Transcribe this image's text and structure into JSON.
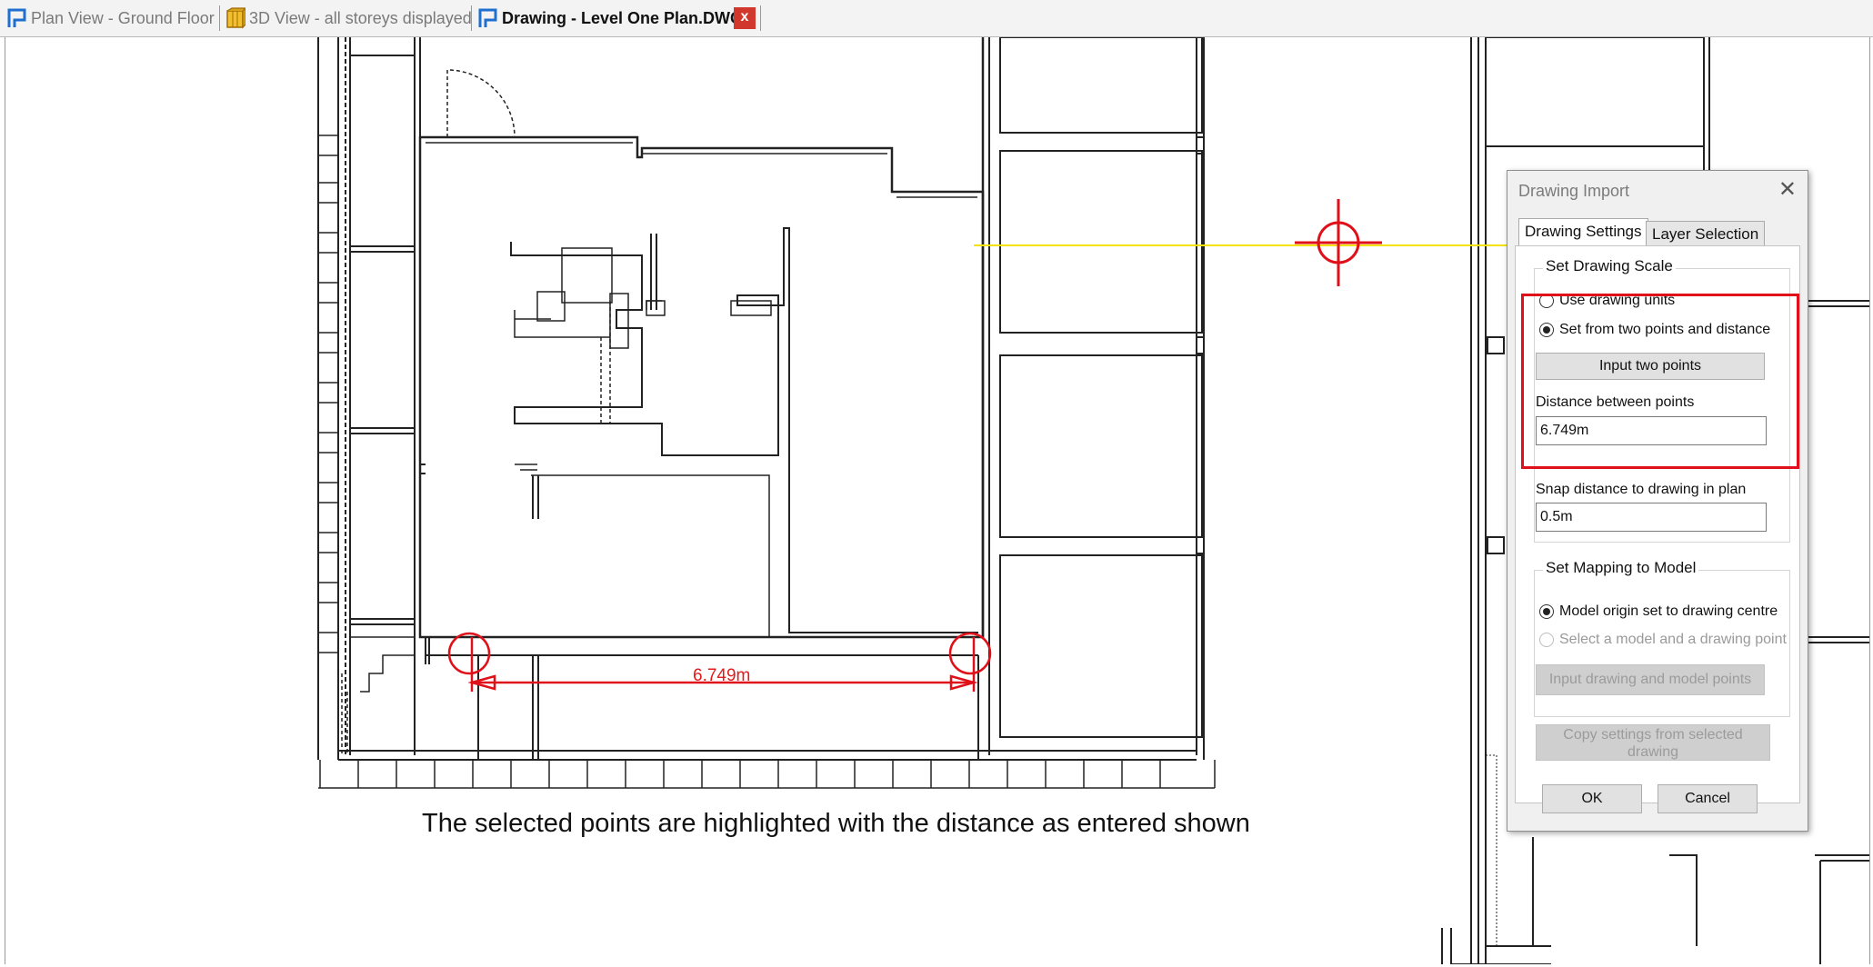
{
  "tabs": [
    {
      "label": "Plan View - Ground Floor",
      "icon": "plan-view-icon",
      "active": false
    },
    {
      "label": "3D View - all storeys displayed",
      "icon": "3d-view-icon",
      "active": false
    },
    {
      "label": "Drawing - Level One Plan.DWG",
      "icon": "drawing-icon",
      "active": true
    }
  ],
  "tab_close_label": "x",
  "drawing": {
    "dimension_label": "6.749m",
    "caption": "The selected points are highlighted with the distance as entered shown"
  },
  "dialog": {
    "title": "Drawing Import",
    "close_glyph": "✕",
    "tabs": [
      "Drawing Settings",
      "Layer Selection"
    ],
    "scale_group": "Set Drawing Scale",
    "scale_options": [
      "Use drawing units",
      "Set from two points and distance"
    ],
    "scale_selected": "Set from two points and distance",
    "input_two_points": "Input two points",
    "distance_label": "Distance between points",
    "distance_value": "6.749m",
    "snap_label": "Snap distance to drawing in plan",
    "snap_value": "0.5m",
    "mapping_group": "Set Mapping to Model",
    "mapping_options": [
      "Model origin set to drawing centre",
      "Select a model and a drawing point"
    ],
    "mapping_selected": "Model origin set to drawing centre",
    "input_model_points": "Input drawing and model points",
    "copy_settings": "Copy settings from selected drawing",
    "ok": "OK",
    "cancel": "Cancel"
  },
  "colors": {
    "highlight": "#e0101a",
    "guide_line": "#f2e400",
    "tab_close": "#d2372d",
    "icon_blue": "#1f6fd1"
  }
}
